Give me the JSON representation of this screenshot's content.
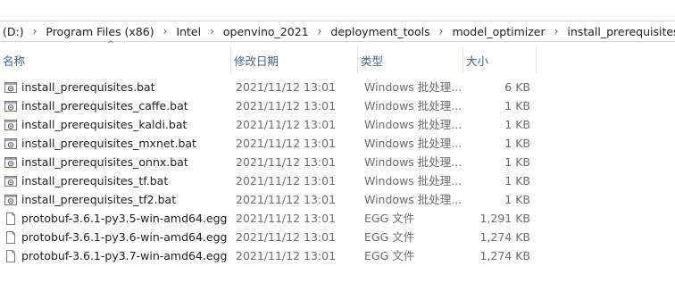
{
  "top_glyph": "",
  "breadcrumb": {
    "segments": [
      "(D:)",
      "Program Files (x86)",
      "Intel",
      "openvino_2021",
      "deployment_tools",
      "model_optimizer",
      "install_prerequisites"
    ],
    "separator": "›"
  },
  "columns": {
    "name": "名称",
    "date": "修改日期",
    "type": "类型",
    "size": "大小",
    "sort_indicator": "^"
  },
  "files": [
    {
      "name": "install_prerequisites.bat",
      "date": "2021/11/12 13:01",
      "type": "Windows 批处理...",
      "size": "6 KB",
      "icon": "batch-file-icon"
    },
    {
      "name": "install_prerequisites_caffe.bat",
      "date": "2021/11/12 13:01",
      "type": "Windows 批处理...",
      "size": "1 KB",
      "icon": "batch-file-icon"
    },
    {
      "name": "install_prerequisites_kaldi.bat",
      "date": "2021/11/12 13:01",
      "type": "Windows 批处理...",
      "size": "1 KB",
      "icon": "batch-file-icon"
    },
    {
      "name": "install_prerequisites_mxnet.bat",
      "date": "2021/11/12 13:01",
      "type": "Windows 批处理...",
      "size": "1 KB",
      "icon": "batch-file-icon"
    },
    {
      "name": "install_prerequisites_onnx.bat",
      "date": "2021/11/12 13:01",
      "type": "Windows 批处理...",
      "size": "1 KB",
      "icon": "batch-file-icon"
    },
    {
      "name": "install_prerequisites_tf.bat",
      "date": "2021/11/12 13:01",
      "type": "Windows 批处理...",
      "size": "1 KB",
      "icon": "batch-file-icon"
    },
    {
      "name": "install_prerequisites_tf2.bat",
      "date": "2021/11/12 13:01",
      "type": "Windows 批处理...",
      "size": "1 KB",
      "icon": "batch-file-icon"
    },
    {
      "name": "protobuf-3.6.1-py3.5-win-amd64.egg",
      "date": "2021/11/12 13:01",
      "type": "EGG 文件",
      "size": "1,291 KB",
      "icon": "generic-file-icon"
    },
    {
      "name": "protobuf-3.6.1-py3.6-win-amd64.egg",
      "date": "2021/11/12 13:01",
      "type": "EGG 文件",
      "size": "1,274 KB",
      "icon": "generic-file-icon"
    },
    {
      "name": "protobuf-3.6.1-py3.7-win-amd64.egg",
      "date": "2021/11/12 13:01",
      "type": "EGG 文件",
      "size": "1,274 KB",
      "icon": "generic-file-icon"
    }
  ]
}
